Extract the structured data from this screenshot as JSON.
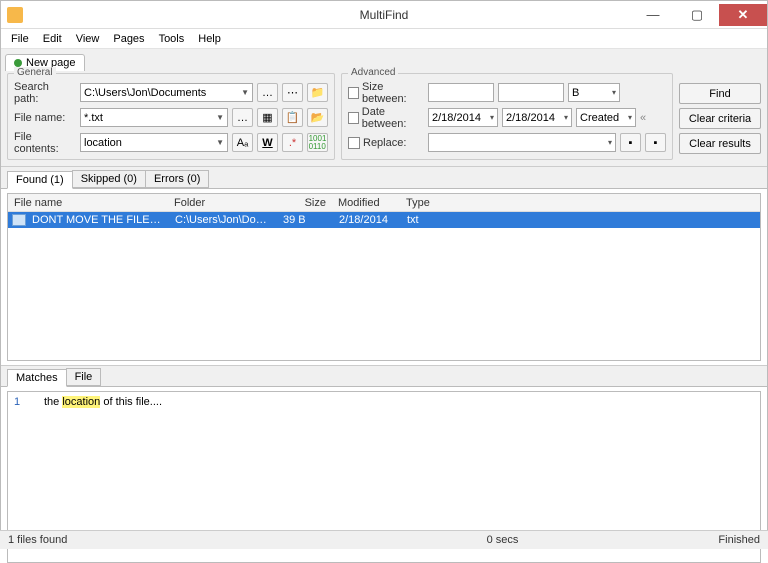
{
  "window": {
    "title": "MultiFind"
  },
  "menu": {
    "file": "File",
    "edit": "Edit",
    "view": "View",
    "pages": "Pages",
    "tools": "Tools",
    "help": "Help"
  },
  "pageTab": {
    "label": "New page"
  },
  "general": {
    "legend": "General",
    "searchPathLabel": "Search path:",
    "searchPath": "C:\\Users\\Jon\\Documents",
    "fileNameLabel": "File name:",
    "fileName": "*.txt",
    "fileContentsLabel": "File contents:",
    "fileContents": "location"
  },
  "advanced": {
    "legend": "Advanced",
    "sizeBetweenLabel": "Size between:",
    "sizeUnit": "B",
    "dateBetweenLabel": "Date between:",
    "dateFrom": "2/18/2014",
    "dateTo": "2/18/2014",
    "dateField": "Created",
    "replaceLabel": "Replace:",
    "backref": "«"
  },
  "actions": {
    "find": "Find",
    "clearCriteria": "Clear criteria",
    "clearResults": "Clear results"
  },
  "resultTabs": {
    "found": "Found (1)",
    "skipped": "Skipped (0)",
    "errors": "Errors (0)"
  },
  "columns": {
    "name": "File name",
    "folder": "Folder",
    "size": "Size",
    "modified": "Modified",
    "type": "Type"
  },
  "rows": [
    {
      "name": "DONT MOVE THE FILE.txt",
      "folder": "C:\\Users\\Jon\\Document...",
      "size": "39 B",
      "modified": "2/18/2014",
      "type": "txt"
    }
  ],
  "matchTabs": {
    "matches": "Matches",
    "file": "File"
  },
  "matchLine": {
    "num": "1",
    "pre": "the ",
    "hit": "location",
    "post": " of this file...."
  },
  "status": {
    "left": "1 files found",
    "mid": "0 secs",
    "right": "Finished"
  }
}
